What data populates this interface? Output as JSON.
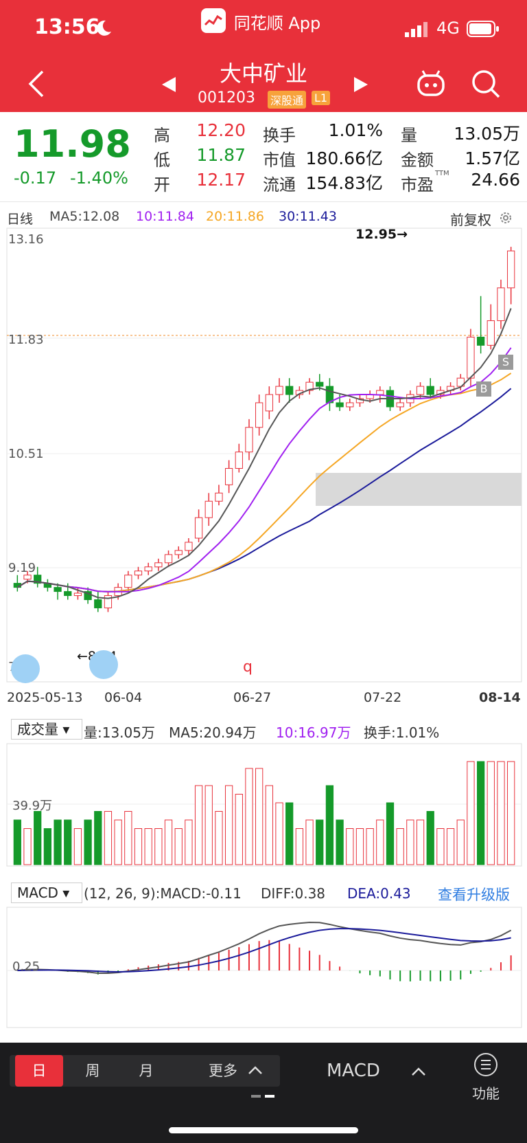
{
  "status": {
    "time": "13:56",
    "network": "4G",
    "app_name": "同花顺 App"
  },
  "header": {
    "stock_name": "大中矿业",
    "stock_code": "001203",
    "tag_market": "深股通",
    "tag_level": "L1"
  },
  "quote": {
    "price": "11.98",
    "change": "-0.17",
    "change_pct": "-1.40%",
    "high_label": "高",
    "high": "12.20",
    "low_label": "低",
    "low": "11.87",
    "open_label": "开",
    "open": "12.17",
    "turnover_label": "换手",
    "turnover": "1.01%",
    "mktcap_label": "市值",
    "mktcap": "180.66亿",
    "float_label": "流通",
    "float": "154.83亿",
    "volume_label": "量",
    "volume": "13.05万",
    "amount_label": "金额",
    "amount": "1.57亿",
    "pe_label": "市盈",
    "pe_sup": "TTM",
    "pe": "24.66"
  },
  "kline": {
    "period": "日线",
    "ma5": "MA5:12.08",
    "ma10": "10:11.84",
    "ma20": "20:11.86",
    "ma30": "30:11.43",
    "adjust": "前复权",
    "y_ticks": [
      "13.16",
      "11.83",
      "10.51",
      "9.19"
    ],
    "y_bottom": "7.8",
    "high_marker": "12.95→",
    "low_marker": "←8.24",
    "dates": [
      "2025-05-13",
      "06-04",
      "06-27",
      "07-22",
      "08-14"
    ],
    "buy_mark": "B",
    "sell_mark": "S",
    "q_mark": "q"
  },
  "volume": {
    "selector": "成交量",
    "vol": "量:13.05万",
    "ma5": "MA5:20.94万",
    "ma10": "10:16.97万",
    "turnover": "换手:1.01%",
    "y_tick": "39.9万"
  },
  "macd": {
    "selector": "MACD",
    "params": "(12, 26, 9):MACD:-0.11",
    "diff": "DIFF:0.38",
    "dea": "DEA:0.43",
    "upgrade": "查看升级版",
    "y_tick": "0.25"
  },
  "bottom": {
    "tab_day": "日",
    "tab_week": "周",
    "tab_month": "月",
    "tab_more": "更多",
    "indicator": "MACD",
    "func": "功能"
  },
  "colors": {
    "up": "#e8303a",
    "down": "#159a2a",
    "ma5": "#555555",
    "ma10": "#a020f0",
    "ma20": "#f5a623",
    "ma30": "#1a1a9a"
  },
  "chart_data": {
    "type": "candlestick",
    "ylim": [
      7.8,
      13.16
    ],
    "candles": [
      [
        8.9,
        9.0,
        8.85,
        8.8
      ],
      [
        8.95,
        9.05,
        9.0,
        8.9
      ],
      [
        9.0,
        9.1,
        8.9,
        8.85
      ],
      [
        8.9,
        8.95,
        8.85,
        8.8
      ],
      [
        8.85,
        8.9,
        8.8,
        8.7
      ],
      [
        8.8,
        8.9,
        8.75,
        8.7
      ],
      [
        8.75,
        8.85,
        8.78,
        8.7
      ],
      [
        8.8,
        8.85,
        8.7,
        8.65
      ],
      [
        8.7,
        8.8,
        8.6,
        8.55
      ],
      [
        8.6,
        8.8,
        8.75,
        8.55
      ],
      [
        8.75,
        8.9,
        8.85,
        8.7
      ],
      [
        8.85,
        9.05,
        9.0,
        8.8
      ],
      [
        9.0,
        9.1,
        9.05,
        8.95
      ],
      [
        9.05,
        9.15,
        9.1,
        9.0
      ],
      [
        9.1,
        9.2,
        9.15,
        9.05
      ],
      [
        9.15,
        9.3,
        9.25,
        9.1
      ],
      [
        9.25,
        9.35,
        9.3,
        9.2
      ],
      [
        9.3,
        9.45,
        9.4,
        9.25
      ],
      [
        9.45,
        9.8,
        9.7,
        9.4
      ],
      [
        9.7,
        10.0,
        9.9,
        9.6
      ],
      [
        9.9,
        10.1,
        10.0,
        9.85
      ],
      [
        10.1,
        10.4,
        10.3,
        10.0
      ],
      [
        10.3,
        10.6,
        10.5,
        10.25
      ],
      [
        10.5,
        10.9,
        10.8,
        10.4
      ],
      [
        10.8,
        11.2,
        11.1,
        10.7
      ],
      [
        11.0,
        11.3,
        11.2,
        10.9
      ],
      [
        11.2,
        11.4,
        11.3,
        11.1
      ],
      [
        11.3,
        11.4,
        11.2,
        11.1
      ],
      [
        11.2,
        11.3,
        11.25,
        11.15
      ],
      [
        11.25,
        11.4,
        11.35,
        11.2
      ],
      [
        11.35,
        11.45,
        11.3,
        11.25
      ],
      [
        11.3,
        11.4,
        11.1,
        11.0
      ],
      [
        11.1,
        11.2,
        11.05,
        11.0
      ],
      [
        11.05,
        11.15,
        11.1,
        11.0
      ],
      [
        11.1,
        11.2,
        11.15,
        11.05
      ],
      [
        11.15,
        11.25,
        11.2,
        11.1
      ],
      [
        11.2,
        11.3,
        11.25,
        11.1
      ],
      [
        11.25,
        11.3,
        11.05,
        11.0
      ],
      [
        11.05,
        11.15,
        11.1,
        11.0
      ],
      [
        11.1,
        11.25,
        11.2,
        11.05
      ],
      [
        11.2,
        11.35,
        11.3,
        11.15
      ],
      [
        11.3,
        11.4,
        11.2,
        11.15
      ],
      [
        11.2,
        11.3,
        11.25,
        11.15
      ],
      [
        11.25,
        11.35,
        11.3,
        11.2
      ],
      [
        11.3,
        11.45,
        11.4,
        11.25
      ],
      [
        11.4,
        12.0,
        11.9,
        11.3
      ],
      [
        11.9,
        12.4,
        11.8,
        11.7
      ],
      [
        11.8,
        12.3,
        12.1,
        11.75
      ],
      [
        12.1,
        12.6,
        12.5,
        12.0
      ],
      [
        12.5,
        13.0,
        12.95,
        12.3
      ]
    ]
  }
}
